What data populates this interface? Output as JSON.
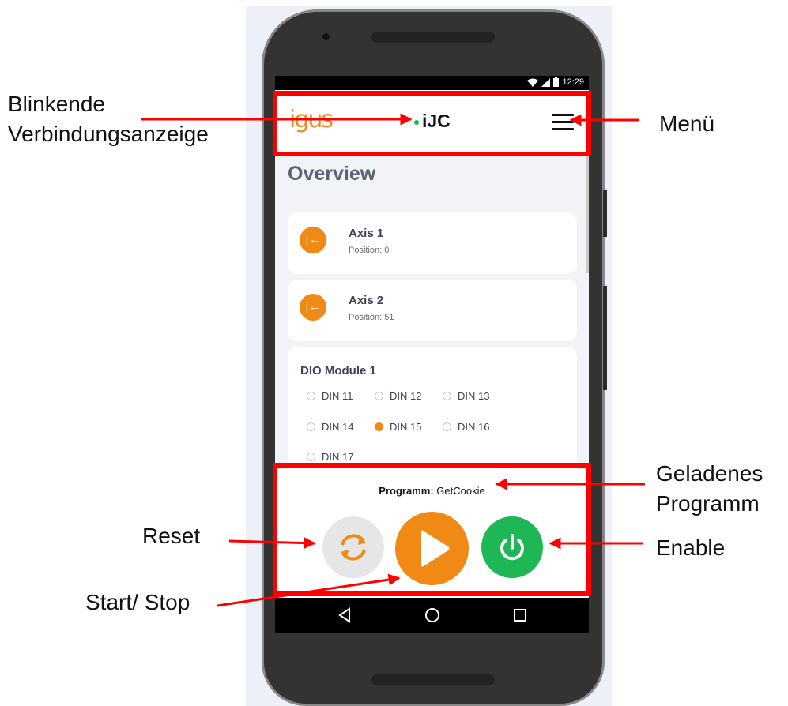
{
  "status_bar": {
    "time": "12:29"
  },
  "app": {
    "logo": "igus",
    "title": "iJC",
    "page_title": "Overview"
  },
  "axes": [
    {
      "name": "Axis 1",
      "position": "Position: 0"
    },
    {
      "name": "Axis 2",
      "position": "Position: 51"
    }
  ],
  "dio": {
    "title": "DIO Module 1",
    "inputs": [
      {
        "label": "DIN 11",
        "active": false
      },
      {
        "label": "DIN 12",
        "active": false
      },
      {
        "label": "DIN 13",
        "active": false
      },
      {
        "label": "DIN 14",
        "active": false
      },
      {
        "label": "DIN 15",
        "active": true
      },
      {
        "label": "DIN 16",
        "active": false
      },
      {
        "label": "DIN 17",
        "active": false
      }
    ]
  },
  "program": {
    "label": "Programm:",
    "name": "GetCookie"
  },
  "annotations": {
    "connection_1": "Blinkende",
    "connection_2": "Verbindungsanzeige",
    "menu": "Menü",
    "loaded_1": "Geladenes",
    "loaded_2": "Programm",
    "reset": "Reset",
    "enable": "Enable",
    "start_stop": "Start/ Stop"
  },
  "colors": {
    "accent": "#f08a14",
    "enable": "#1fb756",
    "connection": "#1fb84b",
    "highlight": "#ff0000"
  },
  "icons": {
    "axis_home": "arrow-left-to-bar-icon",
    "reset": "refresh-icon",
    "play": "play-icon",
    "enable": "power-icon",
    "menu": "hamburger-menu-icon"
  }
}
